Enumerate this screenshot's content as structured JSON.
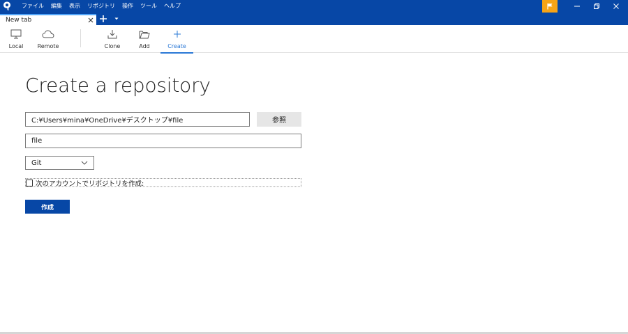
{
  "menubar": {
    "items": [
      "ファイル",
      "編集",
      "表示",
      "リポジトリ",
      "操作",
      "ツール",
      "ヘルプ"
    ]
  },
  "tabs": [
    {
      "title": "New tab"
    }
  ],
  "toolbar": {
    "local_label": "Local",
    "remote_label": "Remote",
    "clone_label": "Clone",
    "add_label": "Add",
    "create_label": "Create",
    "active": "Create"
  },
  "main": {
    "title": "Create a repository",
    "path_value": "C:¥Users¥mina¥OneDrive¥デスクトップ¥file",
    "browse_label": "参照",
    "name_value": "file",
    "repo_type": "Git",
    "account_checkbox_label": "次のアカウントでリポジトリを作成:",
    "account_checked": false,
    "create_button_label": "作成"
  },
  "colors": {
    "titlebar": "#0747a6",
    "accent": "#2a78d6",
    "flag": "#f7a416"
  }
}
